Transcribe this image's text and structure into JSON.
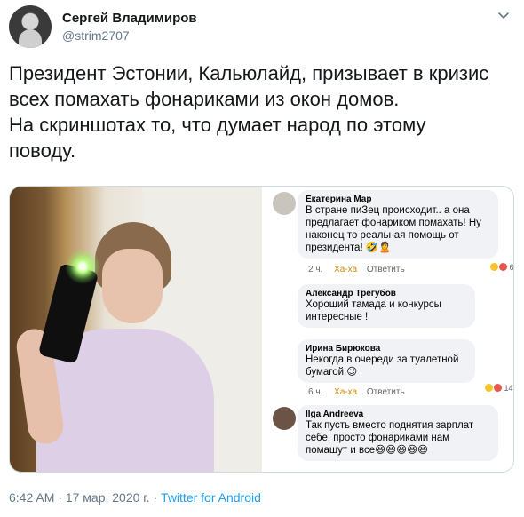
{
  "tweet": {
    "author_name": "Сергей Владимиров",
    "author_handle": "@strim2707",
    "text_lines": [
      "Президент Эстонии, Кальюлайд, призывает в кризис",
      "всех помахать фонариками из окон домов.",
      "На скриншотах то, что думает народ по этому",
      "поводу."
    ],
    "timestamp": "6:42 AM",
    "date": "17 мар. 2020 г.",
    "separator": "·",
    "source": "Twitter for Android"
  },
  "comments": [
    {
      "author": "Екатерина Мар",
      "text": [
        "В стране пиЗец происходит.. а она",
        "предлагает фонариком помахать! Ну",
        "наконец то реальная помощь от",
        "президента! 🤣🙎"
      ],
      "time": "2 ч.",
      "reaction_label": "Ха-ха",
      "reply_label": "Ответить",
      "reaction_count": "6"
    },
    {
      "author": "Александр Трегубов",
      "text": [
        "Хороший тамада и конкурсы",
        "интересные !"
      ]
    },
    {
      "author": "Ирина Бирюкова",
      "text": [
        "Некогда,в очереди за туалетной",
        "бумагой.😉"
      ],
      "time": "6 ч.",
      "reaction_label": "Ха-ха",
      "reply_label": "Ответить",
      "reaction_count": "14"
    },
    {
      "author": "Ilga Andreeva",
      "text": [
        "Так пусть вместо поднятия зарплат",
        "себе, просто фонариками нам",
        "помашут и все😆😆😆😆😆"
      ]
    }
  ],
  "icons": {
    "menu": "chevron-down-icon",
    "avatar": "avatar",
    "reaction": "laugh-emoji-icon"
  },
  "colors": {
    "link": "#1da1f2",
    "secondary_text": "#657786",
    "bubble": "#f0f2f5",
    "haha": "#d18a0b"
  }
}
